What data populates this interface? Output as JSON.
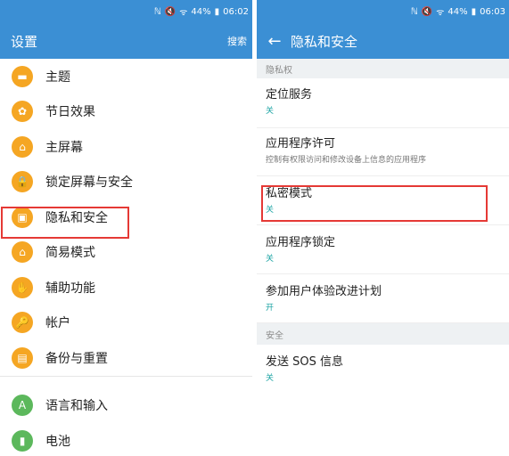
{
  "left": {
    "status": {
      "signal": "ℕ",
      "mute": "🔇",
      "wifi": "ᯤ",
      "battery_pct": "44%",
      "battery": "▮",
      "time": "06:02"
    },
    "app_bar": {
      "title": "设置",
      "search": "搜索"
    },
    "items": [
      {
        "label": "主题",
        "icon": "▬"
      },
      {
        "label": "节日效果",
        "icon": "✿"
      },
      {
        "label": "主屏幕",
        "icon": "⌂"
      },
      {
        "label": "锁定屏幕与安全",
        "icon": "🔒"
      },
      {
        "label": "隐私和安全",
        "icon": "▣"
      },
      {
        "label": "简易模式",
        "icon": "⌂"
      },
      {
        "label": "辅助功能",
        "icon": "✋"
      },
      {
        "label": "帐户",
        "icon": "🔑"
      },
      {
        "label": "备份与重置",
        "icon": "▤"
      }
    ],
    "items2": [
      {
        "label": "语言和输入",
        "icon": "A"
      },
      {
        "label": "电池",
        "icon": "▮"
      }
    ]
  },
  "right": {
    "status": {
      "signal": "ℕ",
      "mute": "🔇",
      "wifi": "ᯤ",
      "battery_pct": "44%",
      "battery": "▮",
      "time": "06:03"
    },
    "app_bar": {
      "back": "←",
      "title": "隐私和安全"
    },
    "section_privacy": "隐私权",
    "pref_location": {
      "title": "定位服务",
      "sub": "关"
    },
    "pref_app_perm": {
      "title": "应用程序许可",
      "sub": "控制有权限访问和修改设备上信息的应用程序"
    },
    "pref_private": {
      "title": "私密模式",
      "sub": "关"
    },
    "pref_app_lock": {
      "title": "应用程序锁定",
      "sub": "关"
    },
    "pref_ux_program": {
      "title": "参加用户体验改进计划",
      "sub": "开"
    },
    "section_security": "安全",
    "pref_sos": {
      "title": "发送 SOS 信息",
      "sub": "关"
    }
  }
}
